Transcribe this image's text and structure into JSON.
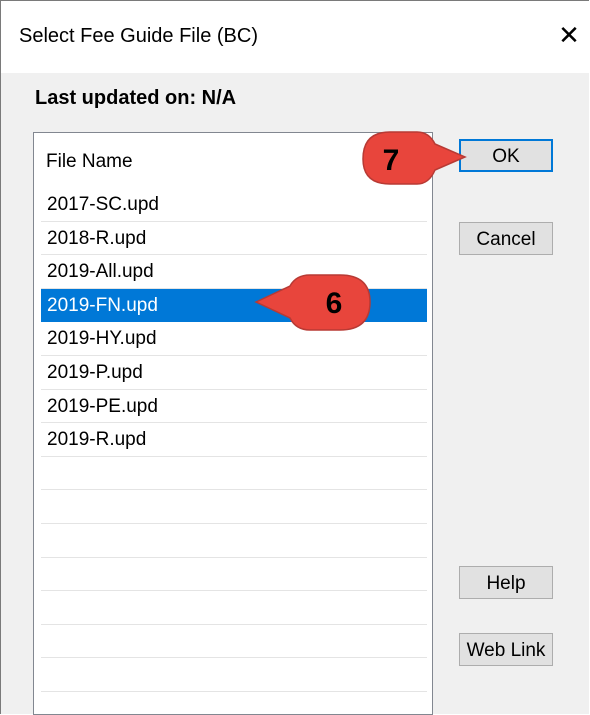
{
  "window": {
    "title": "Select Fee Guide File (BC)",
    "close_glyph": "✕"
  },
  "last_updated": "Last updated on: N/A",
  "file_list": {
    "header": "File Name",
    "files": [
      "2017-SC.upd",
      "2018-R.upd",
      "2019-All.upd",
      "2019-FN.upd",
      "2019-HY.upd",
      "2019-P.upd",
      "2019-PE.upd",
      "2019-R.upd"
    ],
    "selected_index": 3
  },
  "buttons": {
    "ok": "OK",
    "cancel": "Cancel",
    "help": "Help",
    "web_link": "Web Link"
  },
  "callouts": {
    "ok_step": "7",
    "selection_step": "6",
    "color": "#e8453c"
  },
  "colors": {
    "selection": "#0078d7",
    "default_button_border": "#0078d7"
  }
}
